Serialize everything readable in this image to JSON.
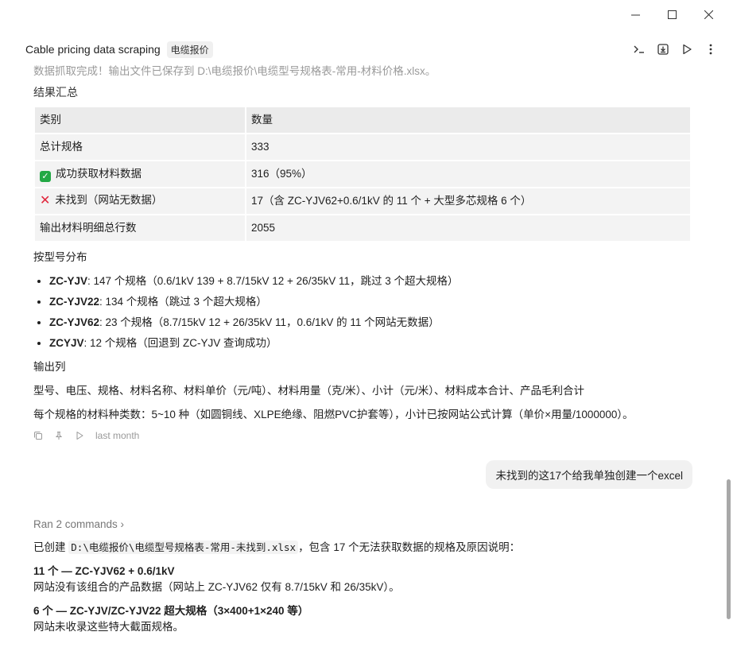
{
  "window": {
    "minimize_icon": "minimize-icon",
    "maximize_icon": "maximize-icon",
    "close_icon": "close-icon"
  },
  "header": {
    "title": "Cable pricing data scraping",
    "tag": "电缆报价",
    "actions": [
      "terminal-icon",
      "download-icon",
      "play-icon",
      "more-vertical-icon"
    ]
  },
  "message": {
    "intro": "数据抓取完成！输出文件已保存到 D:\\电缆报价\\电缆型号规格表-常用-材料价格.xlsx。",
    "summary_heading": "结果汇总",
    "table": {
      "headers": [
        "类别",
        "数量"
      ],
      "rows": [
        {
          "label": "总计规格",
          "value": "333"
        },
        {
          "label": "成功获取材料数据",
          "value": "316（95%）"
        },
        {
          "label": "未找到（网站无数据）",
          "value": "17（含 ZC-YJV62+0.6/1kV 的 11 个 + 大型多芯规格 6 个）"
        },
        {
          "label": "输出材料明细总行数",
          "value": "2055"
        }
      ]
    },
    "model_heading": "按型号分布",
    "models": [
      {
        "name": "ZC-YJV",
        "desc": ": 147 个规格（0.6/1kV 139 + 8.7/15kV 12 + 26/35kV 11，跳过 3 个超大规格）"
      },
      {
        "name": "ZC-YJV22",
        "desc": ": 134 个规格（跳过 3 个超大规格）"
      },
      {
        "name": "ZC-YJV62",
        "desc": ": 23 个规格（8.7/15kV 12 + 26/35kV 11，0.6/1kV 的 11 个网站无数据）"
      },
      {
        "name": "ZCYJV",
        "desc": ": 12 个规格（回退到 ZC-YJV 查询成功）"
      }
    ],
    "output_heading": "输出列",
    "output_cols": "型号、电压、规格、材料名称、材料单价（元/吨）、材料用量（克/米）、小计（元/米）、材料成本合计、产品毛利合计",
    "material_note": "每个规格的材料种类数：5~10 种（如圆铜线、XLPE绝缘、阻燃PVC护套等），小计已按网站公式计算（单价×用量/1000000）。",
    "timestamp": "last month"
  },
  "user_message": "未找到的这17个给我单独创建一个excel",
  "reply": {
    "ran": "Ran 2 commands ›",
    "created_prefix": "已创建 ",
    "created_path": "D:\\电缆报价\\电缆型号规格表-常用-未找到.xlsx",
    "created_suffix": "，包含 17 个无法获取数据的规格及原因说明：",
    "group1_title": "11 个 — ZC-YJV62 + 0.6/1kV",
    "group1_desc": "网站没有该组合的产品数据（网站上 ZC-YJV62 仅有 8.7/15kV 和 26/35kV）。",
    "group2_title": "6 个 — ZC-YJV/ZC-YJV22 超大规格（3×400+1×240 等）",
    "group2_desc": "网站未收录这些特大截面规格。"
  }
}
